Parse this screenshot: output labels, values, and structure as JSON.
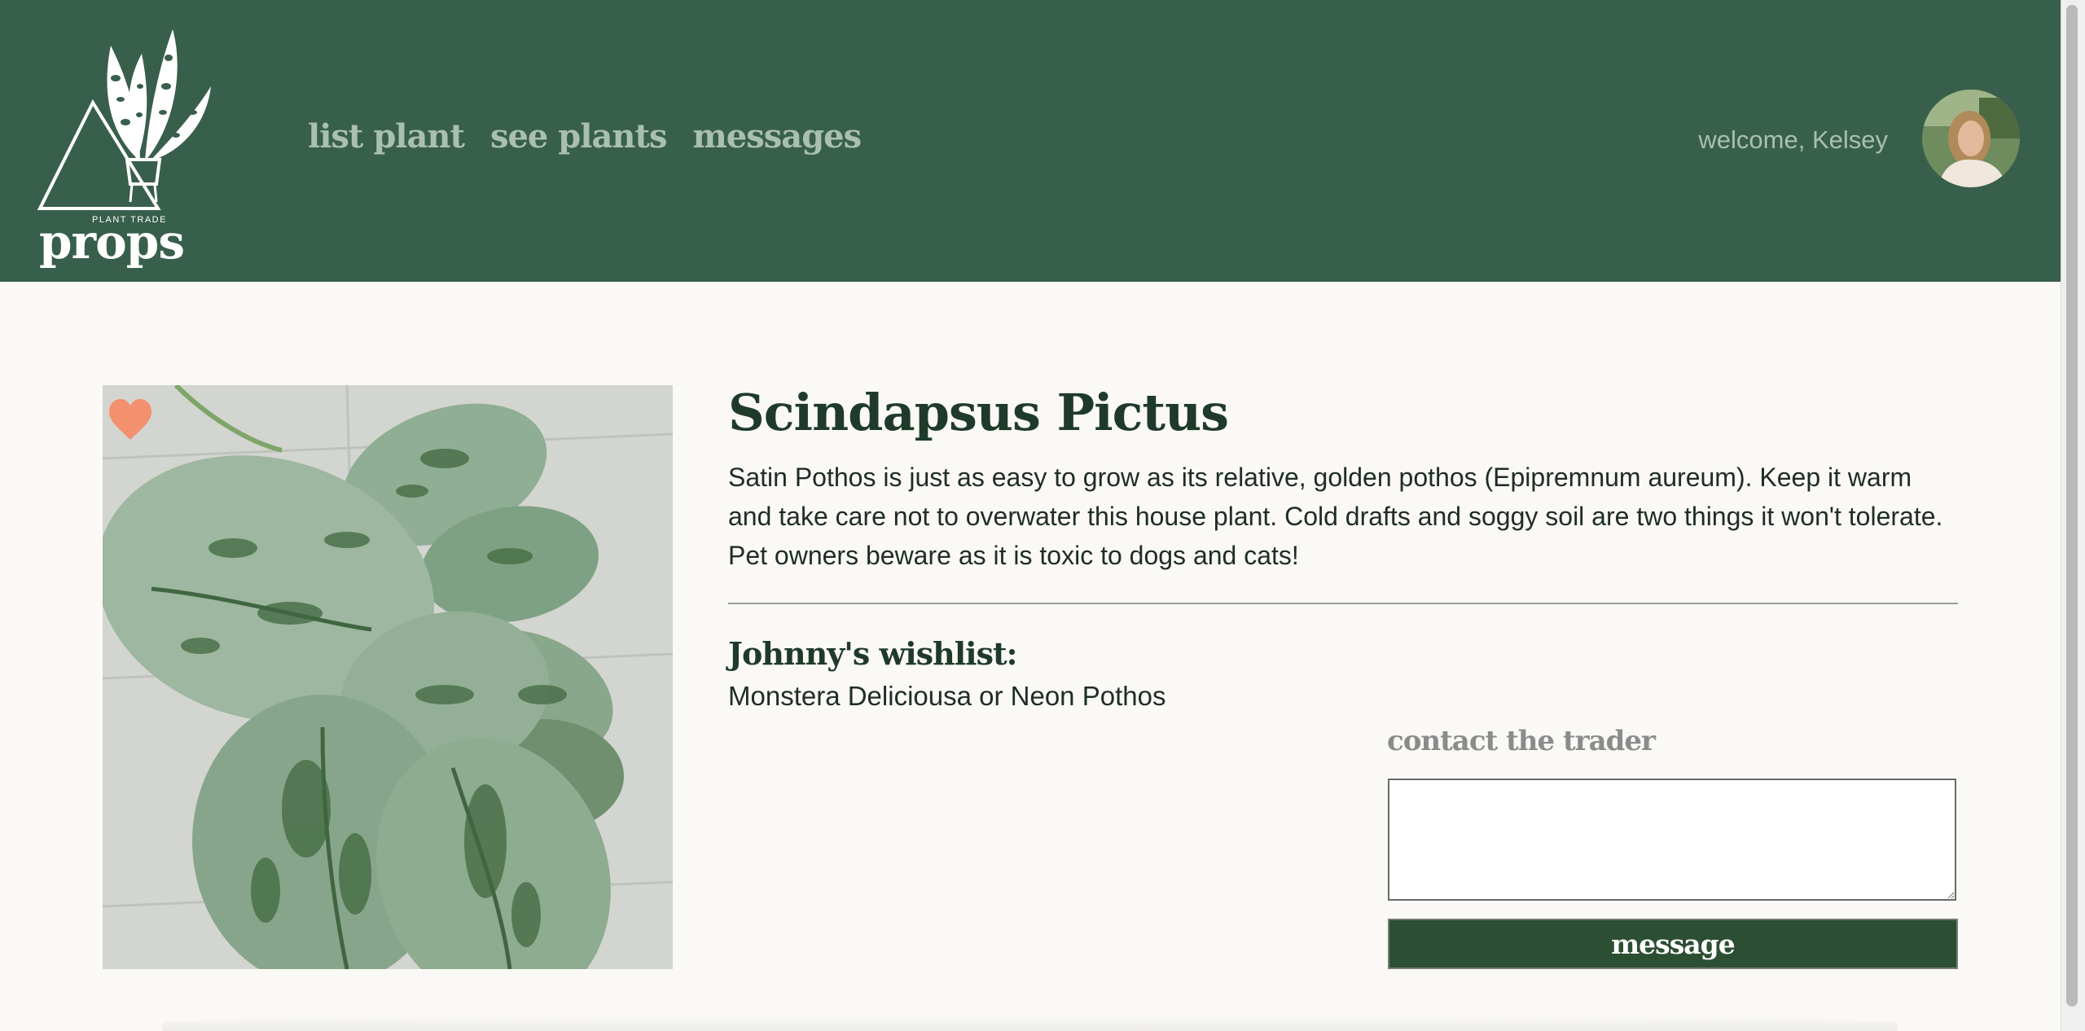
{
  "header": {
    "brand_small": "PLANT TRADE",
    "brand": "props",
    "nav": [
      {
        "label": "list plant"
      },
      {
        "label": "see plants"
      },
      {
        "label": "messages"
      }
    ],
    "welcome": "welcome, Kelsey",
    "colors": {
      "background": "#385f4b",
      "nav_text": "#a9bfb2"
    }
  },
  "plant": {
    "name": "Scindapsus Pictus",
    "description": "Satin Pothos is just as easy to grow as its relative, golden pothos (Epipremnum aureum). Keep it warm and take care not to overwater this house plant. Cold drafts and soggy soil are two things it won't tolerate. Pet owners beware as it is toxic to dogs and cats!",
    "favorite_icon": "heart-icon",
    "favorite_color": "#f3906e"
  },
  "wishlist": {
    "title": "Johnny's wishlist:",
    "items": "Monstera Deliciousa or Neon Pothos"
  },
  "contact": {
    "title": "contact the trader",
    "message_value": "",
    "button_label": "message",
    "button_color": "#2c4e32"
  }
}
